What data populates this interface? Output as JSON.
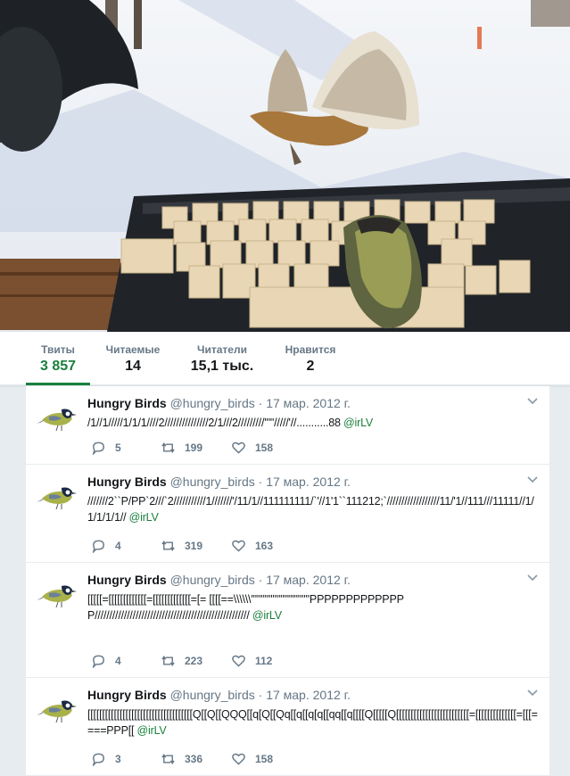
{
  "banner": {
    "image": "hungry-birds-keyboard-photo"
  },
  "stats": [
    {
      "label": "Твиты",
      "value": "3 857",
      "active": true
    },
    {
      "label": "Читаемые",
      "value": "14",
      "active": false
    },
    {
      "label": "Читатели",
      "value": "15,1 тыс.",
      "active": false
    },
    {
      "label": "Нравится",
      "value": "2",
      "active": false
    }
  ],
  "tweets": [
    {
      "name": "Hungry Birds",
      "handle": "@hungry_birds",
      "dot": "·",
      "date": "17 мар. 2012 г.",
      "text": "/1//1/////1/1/1////2///////////////2/1///2/////////'''''/////'//...........88",
      "mention": "@irLV",
      "replies": "5",
      "retweets": "199",
      "likes": "158"
    },
    {
      "name": "Hungry Birds",
      "handle": "@hungry_birds",
      "dot": "·",
      "date": "17 мар. 2012 г.",
      "text": "///////2``P/PP`2///`2///////////1///////'/11/1//111111111/`'//1'1``111212;`//////////////////11/'1//111///11111//1/1/1/1/1//",
      "mention": "@irLV",
      "replies": "4",
      "retweets": "319",
      "likes": "163"
    },
    {
      "name": "Hungry Birds",
      "handle": "@hungry_birds",
      "dot": "·",
      "date": "17 мар. 2012 г.",
      "text": "[[[[[=[[[[[[[[[[[[[=[[[[[[[[[[[[[=[= [[[[==\\\\\\\\\\\\''''''''''''''''''''''''''''''PPPPPPPPPPPPPP/////////////////////////////////////////////////////",
      "mention": "@irLV",
      "replies": "4",
      "retweets": "223",
      "likes": "112"
    },
    {
      "name": "Hungry Birds",
      "handle": "@hungry_birds",
      "dot": "·",
      "date": "17 мар. 2012 г.",
      "text": "[[[[[[[[[[[[[[[[[[[[[[[[[[[[[[[[[[[[Q[[Q[[QQQ[[q[Q[[Qq[[q[[q[q[[qq[[q[[[[Q[[[[[Q[[[[[[[[[[[[[[[[[[[[[[[[[=[[[[[[[[[[[[[[=[[[====PPP[[",
      "mention": "@irLV",
      "replies": "3",
      "retweets": "336",
      "likes": "158"
    }
  ],
  "colors": {
    "accent": "#1a7f3c",
    "muted": "#657786",
    "text": "#14171a"
  }
}
